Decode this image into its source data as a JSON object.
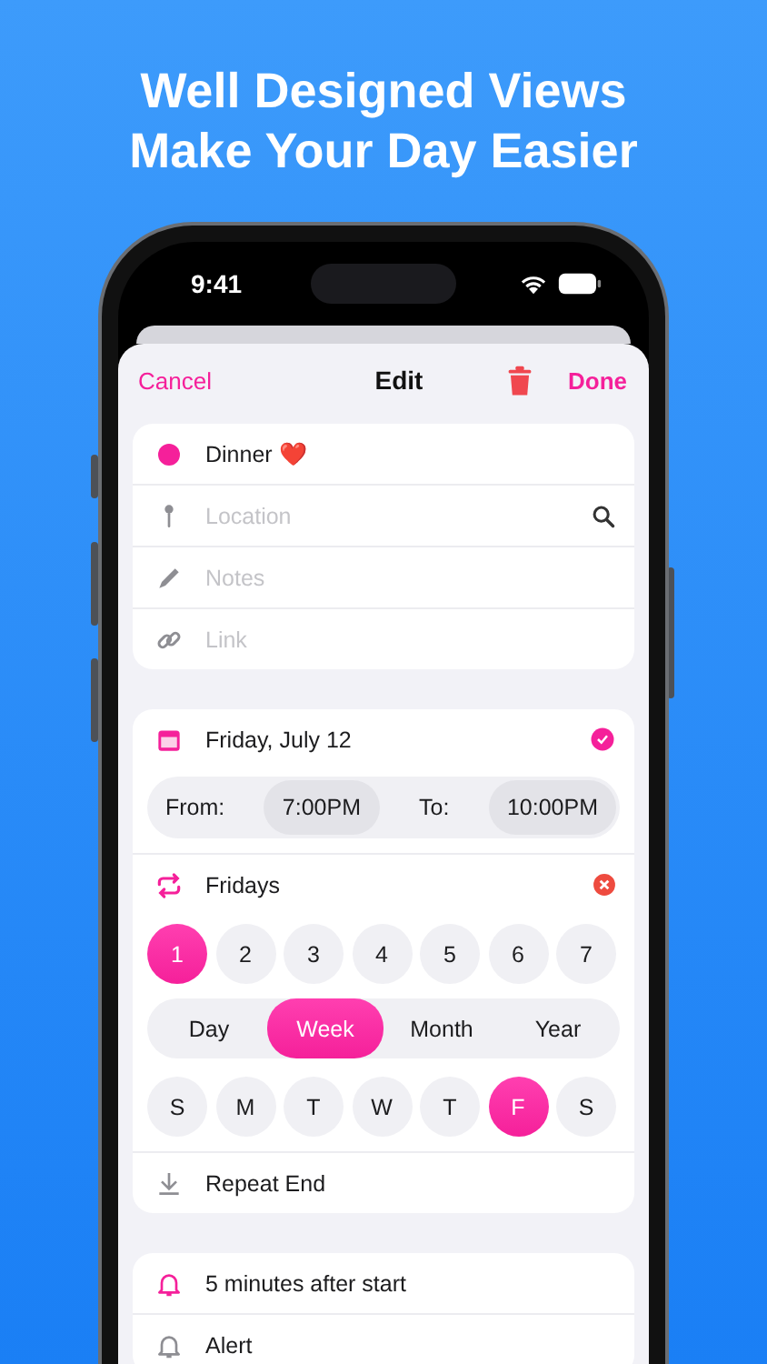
{
  "headline": [
    "Well Designed Views",
    "Make Your Day Easier"
  ],
  "status_bar": {
    "time": "9:41"
  },
  "nav": {
    "cancel": "Cancel",
    "title": "Edit",
    "done": "Done"
  },
  "details": [
    {
      "kind": "title",
      "value": "Dinner ❤️",
      "color": "#f5209a"
    },
    {
      "kind": "location",
      "placeholder": "Location"
    },
    {
      "kind": "notes",
      "placeholder": "Notes"
    },
    {
      "kind": "link",
      "placeholder": "Link"
    }
  ],
  "date": {
    "label": "Friday, July 12",
    "from_label": "From:",
    "from": "7:00PM",
    "to_label": "To:",
    "to": "10:00PM"
  },
  "repeat": {
    "label": "Fridays",
    "intervals": [
      {
        "label": "1",
        "selected": true
      },
      {
        "label": "2",
        "selected": false
      },
      {
        "label": "3",
        "selected": false
      },
      {
        "label": "4",
        "selected": false
      },
      {
        "label": "5",
        "selected": false
      },
      {
        "label": "6",
        "selected": false
      },
      {
        "label": "7",
        "selected": false
      }
    ],
    "frequency": [
      {
        "label": "Day",
        "selected": false
      },
      {
        "label": "Week",
        "selected": true
      },
      {
        "label": "Month",
        "selected": false
      },
      {
        "label": "Year",
        "selected": false
      }
    ],
    "weekdays": [
      {
        "label": "S",
        "selected": false
      },
      {
        "label": "M",
        "selected": false
      },
      {
        "label": "T",
        "selected": false
      },
      {
        "label": "W",
        "selected": false
      },
      {
        "label": "T",
        "selected": false
      },
      {
        "label": "F",
        "selected": true
      },
      {
        "label": "S",
        "selected": false
      }
    ],
    "end": "Repeat End"
  },
  "alerts": [
    {
      "label": "5 minutes after start",
      "active": true
    },
    {
      "label": "Alert",
      "active": false
    }
  ]
}
